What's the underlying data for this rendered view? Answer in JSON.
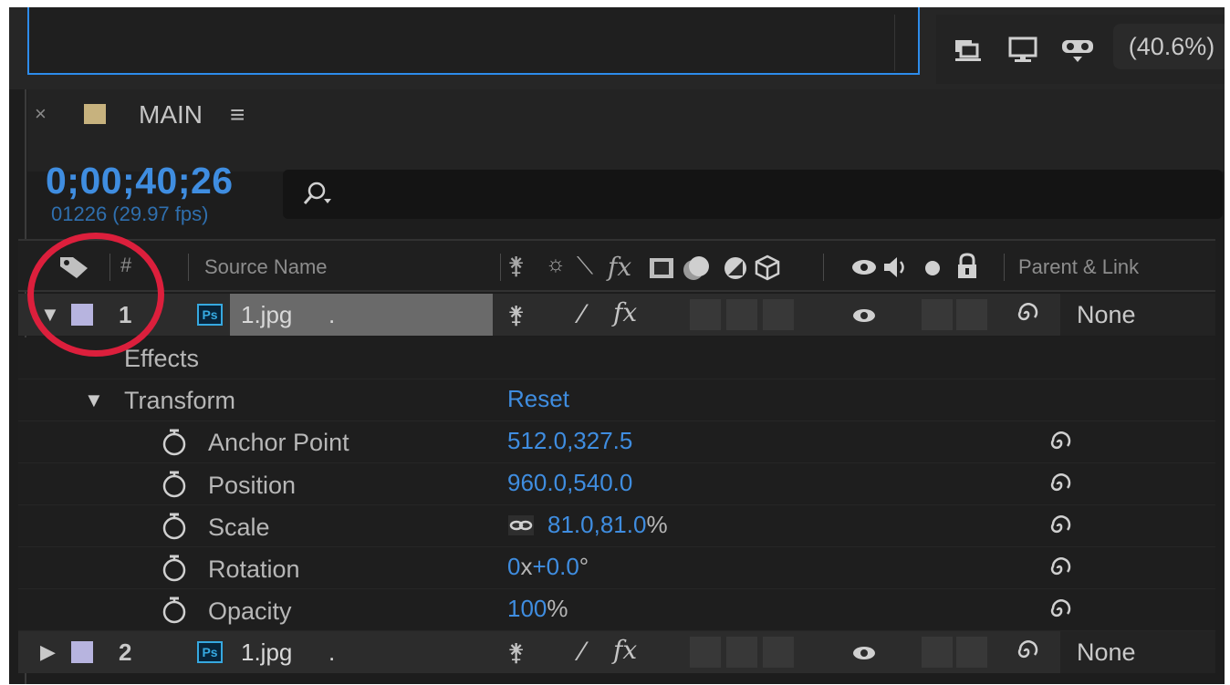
{
  "viewer": {
    "zoom": "(40.6%)"
  },
  "panel": {
    "close": "×",
    "comp_name": "MAIN",
    "menu": "≡",
    "comp_color": "#c7b27e"
  },
  "timecode": {
    "time": "0;00;40;26",
    "frames": "01226 (29.97 fps)"
  },
  "columns": {
    "number": "#",
    "source_name": "Source Name",
    "parent_link": "Parent & Link"
  },
  "layers": [
    {
      "number": "1",
      "name": "1.jpg",
      "suffix": ".",
      "parent": "None",
      "label_color": "#b7b4df"
    },
    {
      "number": "2",
      "name": "1.jpg",
      "suffix": ".",
      "parent": "None",
      "label_color": "#b7b4df"
    }
  ],
  "groups": {
    "effects": "Effects",
    "transform": "Transform",
    "reset": "Reset"
  },
  "properties": [
    {
      "label": "Anchor Point",
      "value": "512.0,327.5",
      "unit": ""
    },
    {
      "label": "Position",
      "value": "960.0,540.0",
      "unit": ""
    },
    {
      "label": "Scale",
      "value": "81.0,81.0",
      "unit": "%"
    },
    {
      "label": "Rotation",
      "value": "0",
      "unit": "x",
      "value2": "+0.0",
      "unit2": "°"
    },
    {
      "label": "Opacity",
      "value": "100",
      "unit": "%"
    }
  ],
  "colors": {
    "accent": "#3f8de0",
    "highlight_circle": "#dc1f3c",
    "ps_badge": "#36a9e1"
  }
}
